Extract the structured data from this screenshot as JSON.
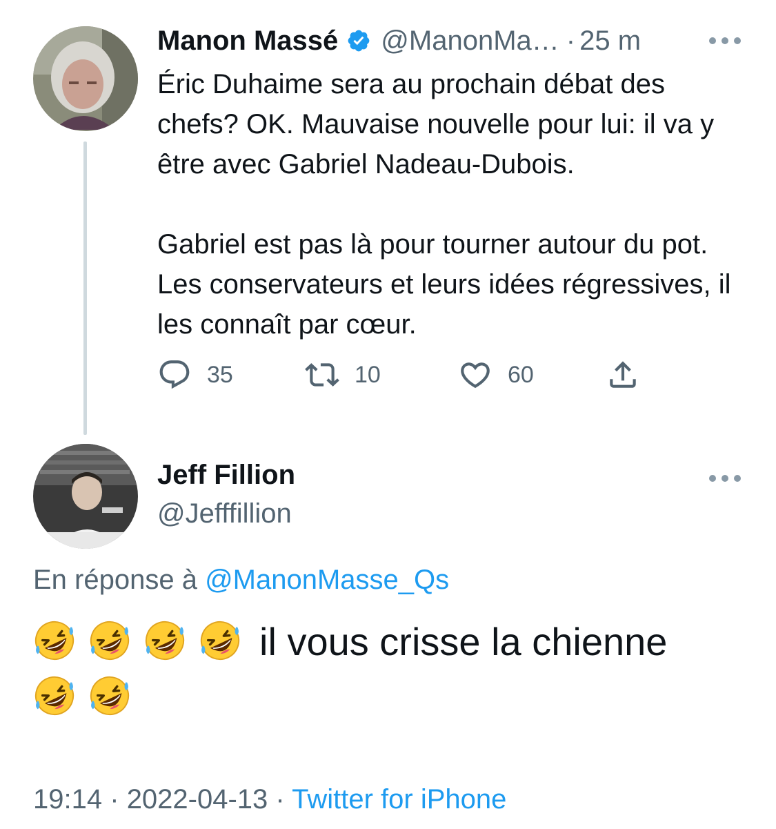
{
  "parent_tweet": {
    "display_name": "Manon Massé",
    "handle": "@ManonMa…",
    "separator": "·",
    "time_ago": "25 m",
    "text": "Éric Duhaime sera au prochain débat des chefs? OK. Mauvaise nouvelle pour lui: il va y être avec Gabriel Nadeau-Dubois.\n\nGabriel est pas là pour tourner autour du pot. Les conservateurs et leurs idées régressives, il les connaît par cœur.",
    "verified": true,
    "actions": {
      "reply_count": "35",
      "retweet_count": "10",
      "like_count": "60"
    },
    "icons": {
      "verified": "verified-badge-icon",
      "reply": "reply-bubble-icon",
      "retweet": "retweet-icon",
      "like": "heart-icon",
      "share": "share-icon",
      "more": "more-options-icon"
    }
  },
  "reply_tweet": {
    "display_name": "Jeff Fillion",
    "handle": "@Jefffillion",
    "replying_to_label": "En réponse à",
    "replying_to_handle": "@ManonMasse_Qs",
    "text": "il vous crisse la chienne",
    "emoji_name": "rolling-on-the-floor-laughing",
    "emoji_count_before": 4,
    "emoji_count_after": 2,
    "timestamp": "19:14",
    "date": "2022-04-13",
    "separator": "·",
    "source": "Twitter for iPhone"
  },
  "colors": {
    "text_primary": "#0f1419",
    "text_secondary": "#536471",
    "link_blue": "#1d9bf0",
    "thread_line": "#cfd9de",
    "verified_blue": "#1d9bf0"
  }
}
